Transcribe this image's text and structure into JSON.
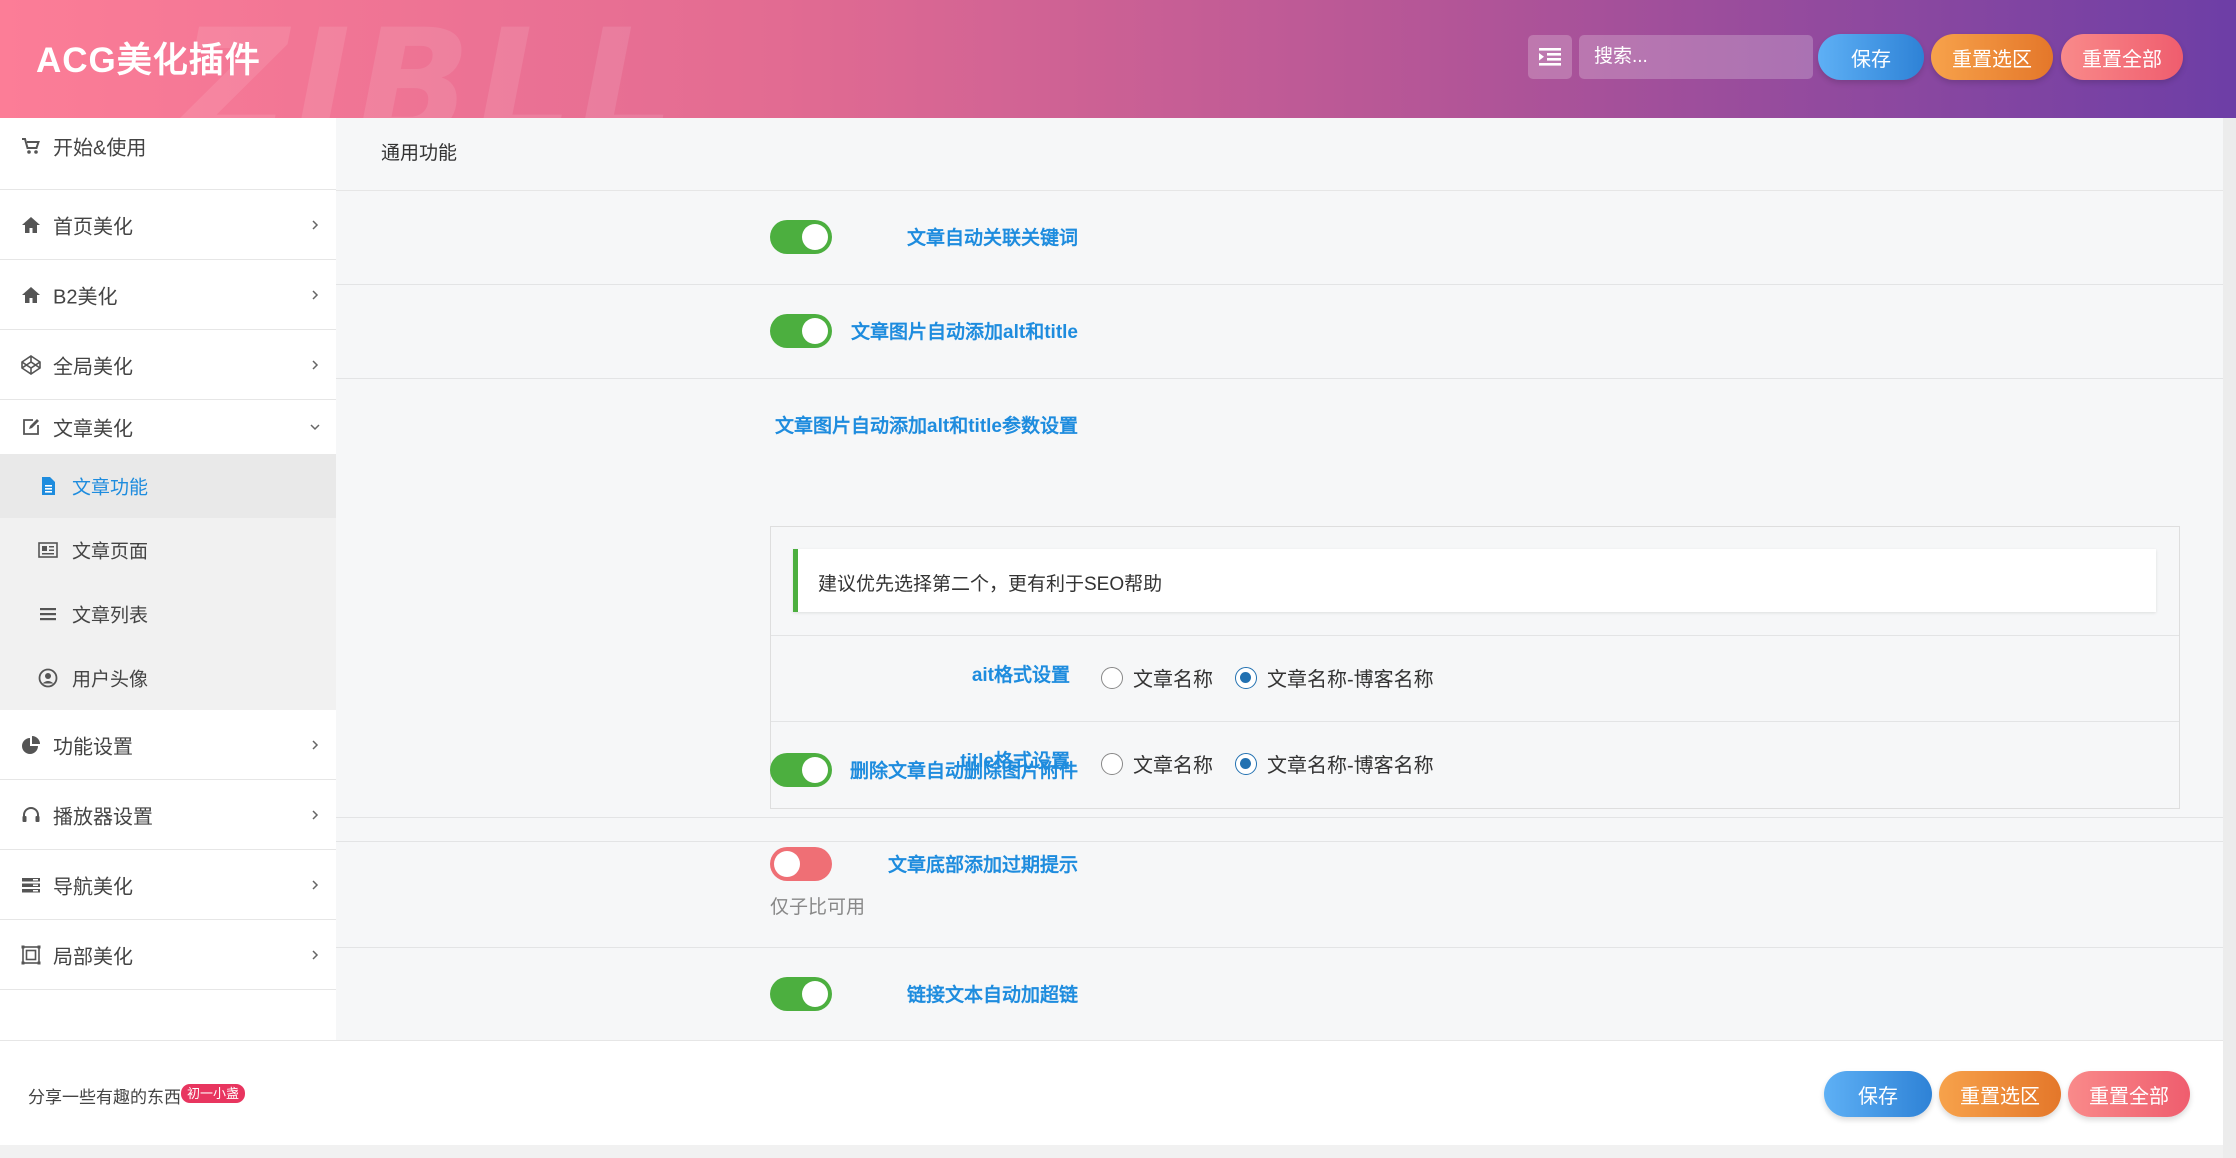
{
  "header": {
    "brand": "ACG美化插件",
    "watermark": "ZIBLL",
    "search_placeholder": "搜索...",
    "save_label": "保存",
    "reset_section_label": "重置选区",
    "reset_all_label": "重置全部"
  },
  "sidebar": {
    "items": [
      {
        "label": "开始&使用",
        "icon": "cart-icon"
      },
      {
        "label": "首页美化",
        "icon": "home-icon"
      },
      {
        "label": "B2美化",
        "icon": "home-icon"
      },
      {
        "label": "全局美化",
        "icon": "codepen-icon"
      },
      {
        "label": "文章美化",
        "icon": "edit-icon"
      },
      {
        "label": "功能设置",
        "icon": "pie-chart-icon"
      },
      {
        "label": "播放器设置",
        "icon": "headphones-icon"
      },
      {
        "label": "导航美化",
        "icon": "nav-icon"
      },
      {
        "label": "局部美化",
        "icon": "frame-icon"
      }
    ],
    "subitems": [
      {
        "label": "文章功能",
        "icon": "file-icon",
        "active": true
      },
      {
        "label": "文章页面",
        "icon": "newspaper-icon"
      },
      {
        "label": "文章列表",
        "icon": "list-icon"
      },
      {
        "label": "用户头像",
        "icon": "user-circle-icon"
      }
    ]
  },
  "main": {
    "section_title": "通用功能",
    "rows": [
      {
        "label": "文章自动关联关键词",
        "enabled": true
      },
      {
        "label": "文章图片自动添加alt和title",
        "enabled": true
      },
      {
        "label": "文章图片自动添加alt和title参数设置"
      },
      {
        "label": "删除文章自动删除图片附件",
        "enabled": true
      },
      {
        "label": "文章底部添加过期提示",
        "enabled": false,
        "help": "仅子比可用"
      },
      {
        "label": "链接文本自动加超链",
        "enabled": true
      }
    ],
    "notice": "建议优先选择第二个，更有利于SEO帮助",
    "alt_setting": {
      "label": "ait格式设置",
      "options": [
        "文章名称",
        "文章名称-博客名称"
      ],
      "selected": "文章名称-博客名称"
    },
    "title_setting": {
      "label": "title格式设置",
      "options": [
        "文章名称",
        "文章名称-博客名称"
      ],
      "selected": "文章名称-博客名称"
    }
  },
  "footer": {
    "text": "分享一些有趣的东西",
    "badge": "初一小盏",
    "save_label": "保存",
    "reset_section_label": "重置选区",
    "reset_all_label": "重置全部"
  },
  "colors": {
    "accent_blue": "#1e8cde",
    "toggle_on": "#4caf3f",
    "toggle_off": "#ef6f75",
    "header_start": "#fc7d97",
    "header_end": "#6d3ea6"
  }
}
